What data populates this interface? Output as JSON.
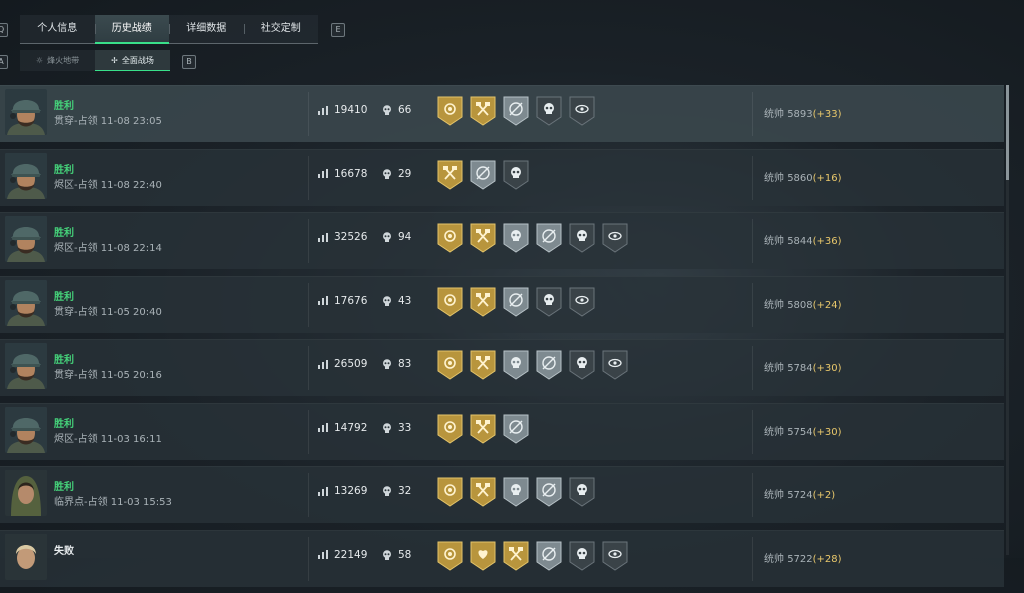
{
  "tabs": [
    "个人信息",
    "历史战绩",
    "详细数据",
    "社交定制"
  ],
  "keys": {
    "left_top": "Q",
    "right_top": "E",
    "left_sub": "A",
    "right_sub": "B"
  },
  "subtabs": [
    "烽火地带",
    "全面战场"
  ],
  "colors": {
    "win": "#45d27a",
    "accent": "#39e08a",
    "delta": "#e9c86b",
    "badge_gold": "#b8953d",
    "badge_silver": "#7e8a90",
    "badge_dark": "#3a4348"
  },
  "matches": [
    {
      "result": "胜利",
      "mode": "贯穿-占领 11-08 23:05",
      "score": "19410",
      "kills": "66",
      "rating_label": "统帅",
      "rating": "5893",
      "delta": "(+33)",
      "badges": [
        "gold-rose",
        "gold-axes",
        "silver-target",
        "dark-skull",
        "dark-eye"
      ],
      "avatar": "helmet-soldier"
    },
    {
      "result": "胜利",
      "mode": "烬区-占领 11-08 22:40",
      "score": "16678",
      "kills": "29",
      "rating_label": "统帅",
      "rating": "5860",
      "delta": "(+16)",
      "badges": [
        "gold-axes",
        "silver-target",
        "dark-skull"
      ],
      "avatar": "helmet-soldier"
    },
    {
      "result": "胜利",
      "mode": "烬区-占领 11-08 22:14",
      "score": "32526",
      "kills": "94",
      "rating_label": "统帅",
      "rating": "5844",
      "delta": "(+36)",
      "badges": [
        "gold-rose",
        "gold-axes",
        "silver-skull",
        "silver-target",
        "dark-skull",
        "dark-eye"
      ],
      "avatar": "helmet-soldier"
    },
    {
      "result": "胜利",
      "mode": "贯穿-占领 11-05 20:40",
      "score": "17676",
      "kills": "43",
      "rating_label": "统帅",
      "rating": "5808",
      "delta": "(+24)",
      "badges": [
        "gold-rose",
        "gold-axes",
        "silver-target",
        "dark-skull",
        "dark-eye"
      ],
      "avatar": "helmet-soldier"
    },
    {
      "result": "胜利",
      "mode": "贯穿-占领 11-05 20:16",
      "score": "26509",
      "kills": "83",
      "rating_label": "统帅",
      "rating": "5784",
      "delta": "(+30)",
      "badges": [
        "gold-rose",
        "gold-axes",
        "silver-skull",
        "silver-target",
        "dark-skull",
        "dark-eye"
      ],
      "avatar": "helmet-soldier"
    },
    {
      "result": "胜利",
      "mode": "烬区-占领 11-03 16:11",
      "score": "14792",
      "kills": "33",
      "rating_label": "统帅",
      "rating": "5754",
      "delta": "(+30)",
      "badges": [
        "gold-rose",
        "gold-axes",
        "silver-target"
      ],
      "avatar": "helmet-soldier"
    },
    {
      "result": "胜利",
      "mode": "临界点-占领 11-03 15:53",
      "score": "13269",
      "kills": "32",
      "rating_label": "统帅",
      "rating": "5724",
      "delta": "(+2)",
      "badges": [
        "gold-rose",
        "gold-axes",
        "silver-skull",
        "silver-target",
        "dark-skull"
      ],
      "avatar": "hooded-woman"
    },
    {
      "result": "失败",
      "mode": "",
      "score": "22149",
      "kills": "58",
      "rating_label": "统帅",
      "rating": "5722",
      "delta": "(+28)",
      "badges": [
        "gold-rose",
        "gold-heart",
        "gold-axes",
        "silver-target",
        "dark-skull",
        "dark-eye"
      ],
      "avatar": "blond-soldier"
    }
  ]
}
